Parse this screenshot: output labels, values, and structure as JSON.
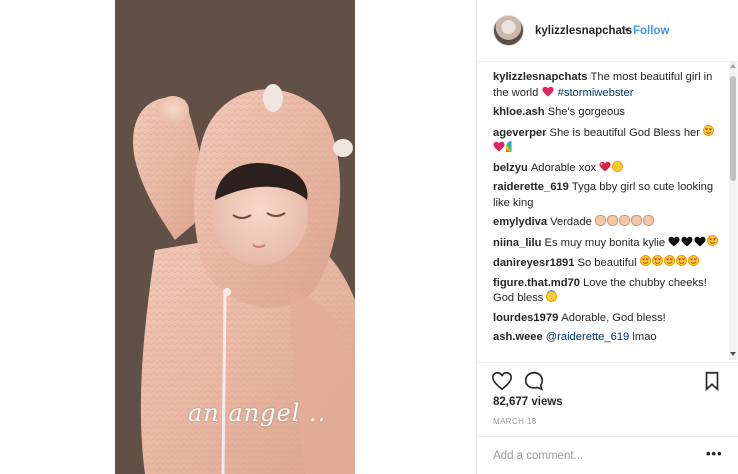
{
  "post": {
    "overlay_caption": "an angel ..",
    "views": "82,677 views",
    "date": "MARCH 18"
  },
  "header": {
    "username": "kylizzlesnapchats",
    "separator": "•",
    "follow_label": "Follow"
  },
  "comments": [
    {
      "user": "kylizzlesnapchats",
      "text": "The most beautiful girl in the world",
      "emojis_after": [
        "red-heart"
      ],
      "hashtag": "#stormiwebster"
    },
    {
      "user": "khloe.ash",
      "text": "She's gorgeous"
    },
    {
      "user": "ageverper",
      "text": "She is beautiful God Bless her",
      "emojis_after": [
        "heart-eyes-face",
        "red-heart",
        "rainbow"
      ]
    },
    {
      "user": "belzyu",
      "text": "Adorable xox",
      "emojis_after": [
        "sparkling-heart",
        "blowing-kiss-face"
      ]
    },
    {
      "user": "raiderette_619",
      "text": "Tyga bby girl so cute looking like king"
    },
    {
      "user": "emylydiva",
      "text": "Verdade",
      "emojis_after": [
        "clapping-hands",
        "clapping-hands",
        "clapping-hands",
        "clapping-hands",
        "clapping-hands"
      ]
    },
    {
      "user": "niina_lilu",
      "text": "Es muy muy bonita kylie",
      "emojis_after": [
        "black-heart",
        "black-heart",
        "black-heart",
        "heart-eyes-face"
      ]
    },
    {
      "user": "danireyesr1891",
      "text": "So beautiful",
      "emojis_after": [
        "heart-eyes-face",
        "heart-eyes-face",
        "heart-eyes-face",
        "heart-eyes-face",
        "heart-eyes-face"
      ]
    },
    {
      "user": "figure.that.md70",
      "text": "Love the chubby cheeks! God bless",
      "emojis_after": [
        "smiling-halo-face"
      ]
    },
    {
      "user": "lourdes1979",
      "text": "Adorable, God bless!"
    },
    {
      "user": "ash.weee",
      "mention": "@raiderette_619",
      "text": "lmao"
    }
  ],
  "add_comment": {
    "placeholder": "Add a comment...",
    "more_label": "•••"
  },
  "icons": {
    "like": "heart-outline-icon",
    "comment": "speech-bubble-icon",
    "save": "bookmark-icon"
  },
  "colors": {
    "accent": "#3897f0",
    "mention": "#003569",
    "text": "#262626",
    "muted": "#999999",
    "border": "#efefef",
    "emoji_heart": "#e0245e"
  }
}
